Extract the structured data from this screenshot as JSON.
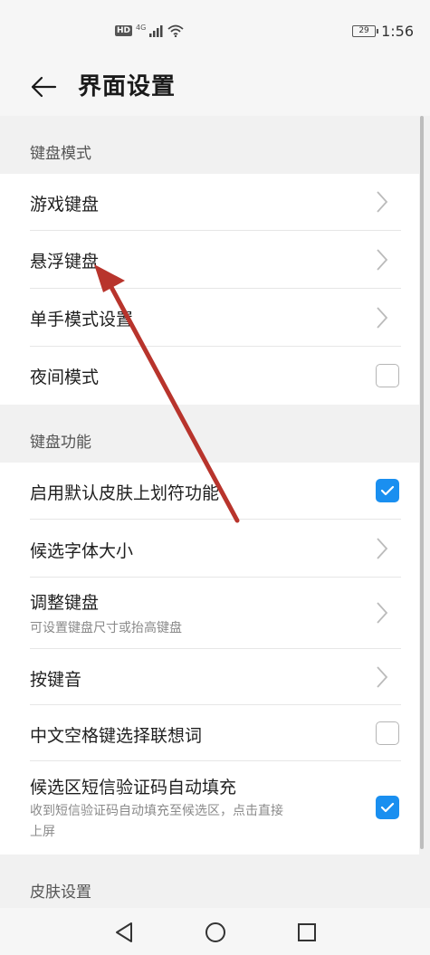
{
  "status_bar": {
    "hd": "HD",
    "network": "4G",
    "battery": "29",
    "time": "1:56"
  },
  "header": {
    "title": "界面设置",
    "back_icon": "back-arrow-icon"
  },
  "sections": [
    {
      "title": "键盘模式",
      "items": [
        {
          "label": "游戏键盘",
          "control": "chevron"
        },
        {
          "label": "悬浮键盘",
          "control": "chevron"
        },
        {
          "label": "单手模式设置",
          "control": "chevron"
        },
        {
          "label": "夜间模式",
          "control": "checkbox",
          "checked": false
        }
      ]
    },
    {
      "title": "键盘功能",
      "items": [
        {
          "label": "启用默认皮肤上划符功能",
          "control": "checkbox",
          "checked": true
        },
        {
          "label": "候选字体大小",
          "control": "chevron"
        },
        {
          "label": "调整键盘",
          "sublabel": "可设置键盘尺寸或抬高键盘",
          "control": "chevron"
        },
        {
          "label": "按键音",
          "control": "chevron"
        },
        {
          "label": "中文空格键选择联想词",
          "control": "checkbox",
          "checked": false
        },
        {
          "label": "候选区短信验证码自动填充",
          "sublabel_line1": "收到短信验证码自动填充至候选区，点击直接",
          "sublabel_line2": "上屏",
          "control": "checkbox",
          "checked": true
        }
      ]
    },
    {
      "title": "皮肤设置",
      "items": []
    }
  ],
  "nav_bar": {
    "back_icon": "triangle-back-icon",
    "home_icon": "circle-home-icon",
    "recents_icon": "square-recents-icon"
  },
  "colors": {
    "accent": "#1a8ff0",
    "annotation_arrow": "#b8342c"
  }
}
